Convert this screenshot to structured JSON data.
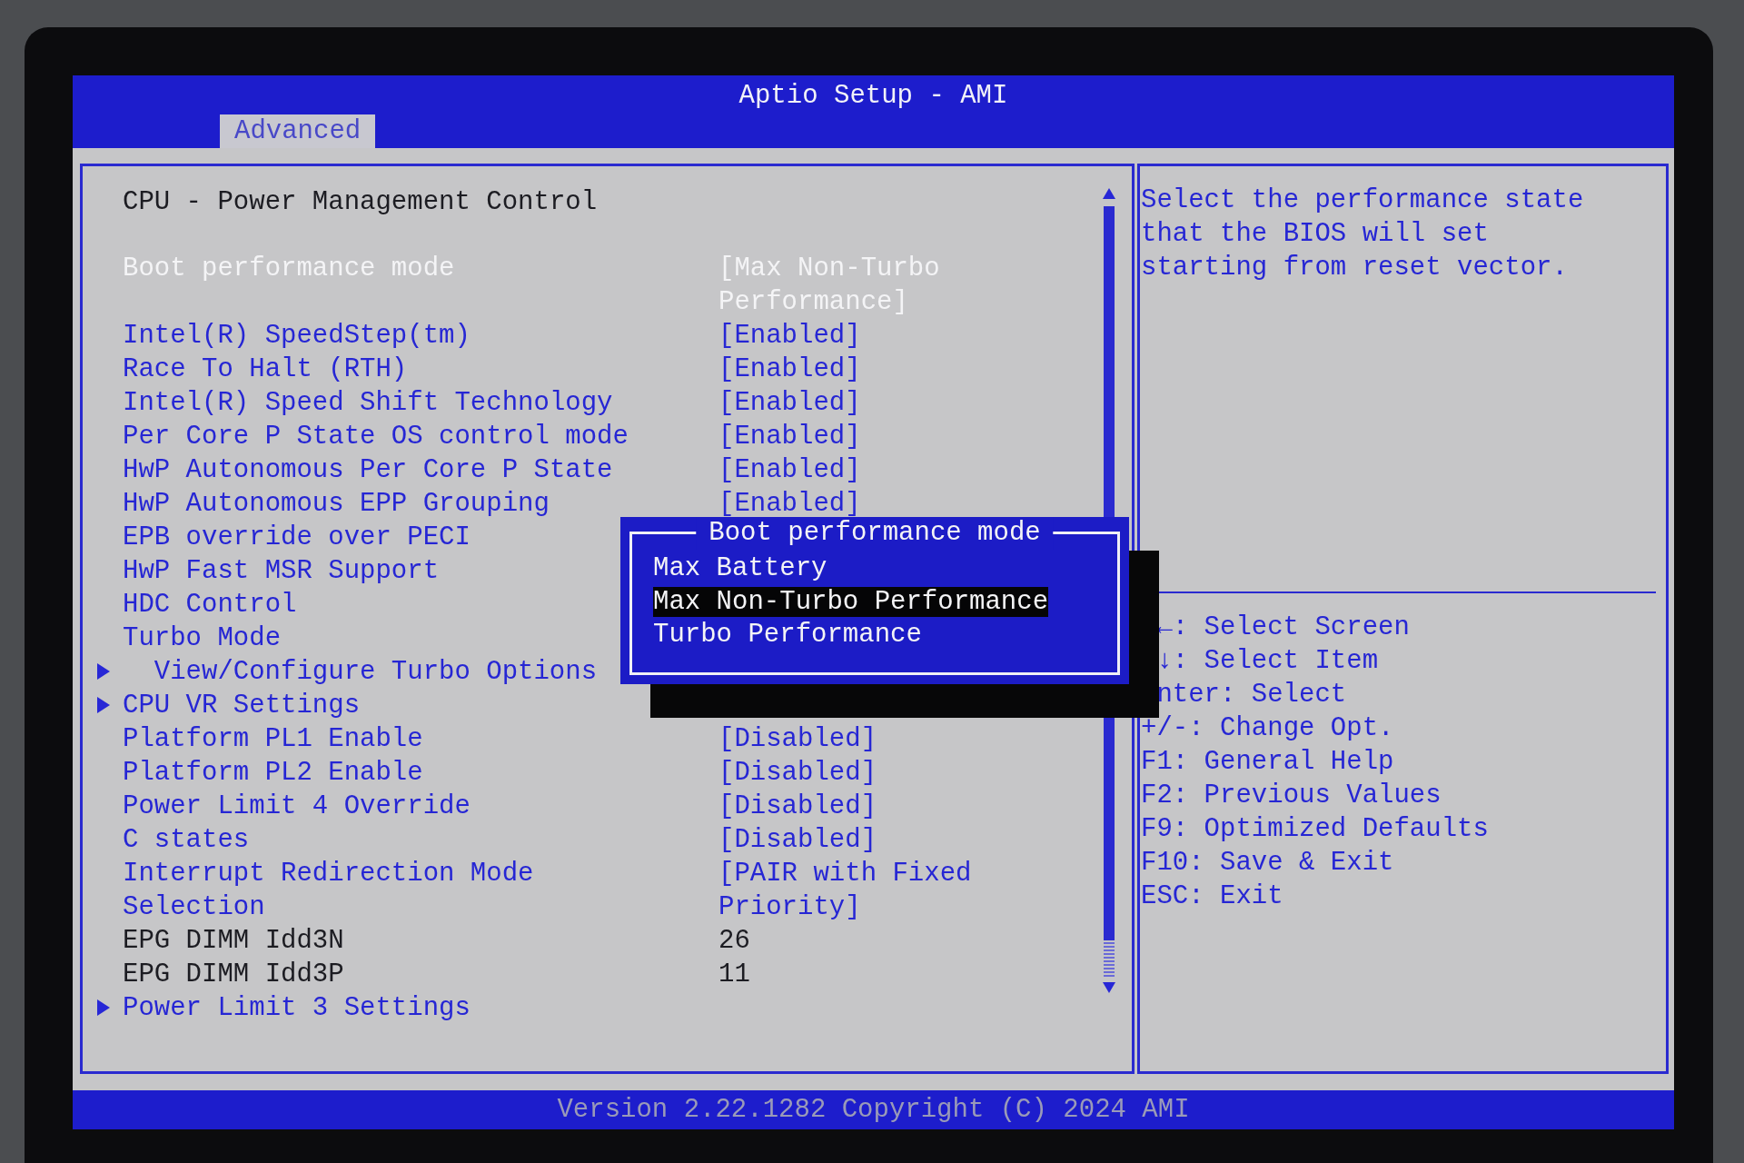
{
  "window": {
    "title": "Aptio Setup - AMI"
  },
  "tabs": [
    {
      "label": "Advanced",
      "selected": true
    }
  ],
  "page_title": "CPU - Power Management Control",
  "items": [
    {
      "kind": "setting",
      "label": "Boot performance mode",
      "value": "[Max Non-Turbo\nPerformance]",
      "selected": true
    },
    {
      "kind": "setting",
      "label": "Intel(R) SpeedStep(tm)",
      "value": "[Enabled]",
      "selected": false
    },
    {
      "kind": "setting",
      "label": "Race To Halt (RTH)",
      "value": "[Enabled]",
      "selected": false
    },
    {
      "kind": "setting",
      "label": "Intel(R) Speed Shift Technology",
      "value": "[Enabled]",
      "selected": false
    },
    {
      "kind": "setting",
      "label": "Per Core P State OS control mode",
      "value": "[Enabled]",
      "selected": false
    },
    {
      "kind": "setting",
      "label": "HwP Autonomous Per Core P State",
      "value": "[Enabled]",
      "selected": false
    },
    {
      "kind": "setting",
      "label": "HwP Autonomous EPP Grouping",
      "value": "[Enabled]",
      "selected": false
    },
    {
      "kind": "setting",
      "label": "EPB override over PECI",
      "selected": false
    },
    {
      "kind": "setting",
      "label": "HwP Fast MSR Support",
      "selected": false
    },
    {
      "kind": "setting",
      "label": "HDC Control",
      "selected": false
    },
    {
      "kind": "setting",
      "label": "Turbo Mode",
      "selected": false,
      "children": [
        {
          "kind": "submenu",
          "label": "View/Configure Turbo Options",
          "selected": false
        }
      ]
    },
    {
      "kind": "submenu",
      "label": "CPU VR Settings",
      "selected": false
    },
    {
      "kind": "setting",
      "label": "Platform PL1 Enable",
      "value": "[Disabled]",
      "selected": false
    },
    {
      "kind": "setting",
      "label": "Platform PL2 Enable",
      "value": "[Disabled]",
      "selected": false
    },
    {
      "kind": "setting",
      "label": "Power Limit 4 Override",
      "value": "[Disabled]",
      "selected": false
    },
    {
      "kind": "setting",
      "label": "C states",
      "value": "[Disabled]",
      "selected": false
    },
    {
      "kind": "setting",
      "label": "Interrupt Redirection Mode\nSelection",
      "value": "[PAIR with Fixed\nPriority]",
      "selected": false
    },
    {
      "kind": "info",
      "label": "EPG DIMM Idd3N",
      "value": "26",
      "selected": false
    },
    {
      "kind": "info",
      "label": "EPG DIMM Idd3P",
      "value": "11",
      "selected": false
    },
    {
      "kind": "submenu",
      "label": "Power Limit 3 Settings",
      "selected": false
    }
  ],
  "popup": {
    "title": "Boot performance mode",
    "options": [
      {
        "label": "Max Battery",
        "selected": false
      },
      {
        "label": "Max Non-Turbo Performance",
        "selected": true
      },
      {
        "label": "Turbo Performance",
        "selected": false
      }
    ]
  },
  "help": {
    "description": "Select the performance state\nthat the BIOS will set\nstarting from reset vector.",
    "keys": [
      {
        "text": "←: Select Screen",
        "obscured": true
      },
      {
        "text": "↓: Select Item",
        "obscured": true
      },
      {
        "text": "nter: Select",
        "obscured": true
      },
      {
        "text": "+/-: Change Opt.",
        "obscured": false
      },
      {
        "text": "F1: General Help",
        "obscured": false
      },
      {
        "text": "F2: Previous Values",
        "obscured": false
      },
      {
        "text": "F9: Optimized Defaults",
        "obscured": false
      },
      {
        "text": "F10: Save & Exit",
        "obscured": false
      },
      {
        "text": "ESC: Exit",
        "obscured": false
      }
    ]
  },
  "status_bar": "Version 2.22.1282 Copyright (C) 2024 AMI"
}
